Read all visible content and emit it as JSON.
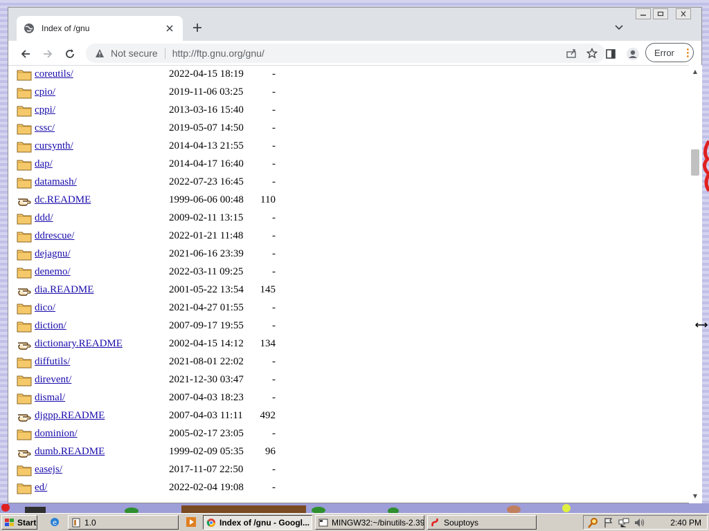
{
  "browser": {
    "tab_title": "Index of /gnu",
    "security_label": "Not secure",
    "url": "http://ftp.gnu.org/gnu/",
    "error_label": "Error"
  },
  "listing": [
    {
      "name": "coreutils/",
      "date": "2022-04-15 18:19",
      "size": "-",
      "type": "folder"
    },
    {
      "name": "cpio/",
      "date": "2019-11-06 03:25",
      "size": "-",
      "type": "folder"
    },
    {
      "name": "cppi/",
      "date": "2013-03-16 15:40",
      "size": "-",
      "type": "folder"
    },
    {
      "name": "cssc/",
      "date": "2019-05-07 14:50",
      "size": "-",
      "type": "folder"
    },
    {
      "name": "cursynth/",
      "date": "2014-04-13 21:55",
      "size": "-",
      "type": "folder"
    },
    {
      "name": "dap/",
      "date": "2014-04-17 16:40",
      "size": "-",
      "type": "folder"
    },
    {
      "name": "datamash/",
      "date": "2022-07-23 16:45",
      "size": "-",
      "type": "folder"
    },
    {
      "name": "dc.README",
      "date": "1999-06-06 00:48",
      "size": "110",
      "type": "readme"
    },
    {
      "name": "ddd/",
      "date": "2009-02-11 13:15",
      "size": "-",
      "type": "folder"
    },
    {
      "name": "ddrescue/",
      "date": "2022-01-21 11:48",
      "size": "-",
      "type": "folder"
    },
    {
      "name": "dejagnu/",
      "date": "2021-06-16 23:39",
      "size": "-",
      "type": "folder"
    },
    {
      "name": "denemo/",
      "date": "2022-03-11 09:25",
      "size": "-",
      "type": "folder"
    },
    {
      "name": "dia.README",
      "date": "2001-05-22 13:54",
      "size": "145",
      "type": "readme"
    },
    {
      "name": "dico/",
      "date": "2021-04-27 01:55",
      "size": "-",
      "type": "folder"
    },
    {
      "name": "diction/",
      "date": "2007-09-17 19:55",
      "size": "-",
      "type": "folder"
    },
    {
      "name": "dictionary.README",
      "date": "2002-04-15 14:12",
      "size": "134",
      "type": "readme"
    },
    {
      "name": "diffutils/",
      "date": "2021-08-01 22:02",
      "size": "-",
      "type": "folder"
    },
    {
      "name": "direvent/",
      "date": "2021-12-30 03:47",
      "size": "-",
      "type": "folder"
    },
    {
      "name": "dismal/",
      "date": "2007-04-03 18:23",
      "size": "-",
      "type": "folder"
    },
    {
      "name": "djgpp.README",
      "date": "2007-04-03 11:11",
      "size": "492",
      "type": "readme"
    },
    {
      "name": "dominion/",
      "date": "2005-02-17 23:05",
      "size": "-",
      "type": "folder"
    },
    {
      "name": "dumb.README",
      "date": "1999-02-09 05:35",
      "size": "96",
      "type": "readme"
    },
    {
      "name": "easejs/",
      "date": "2017-11-07 22:50",
      "size": "-",
      "type": "folder"
    },
    {
      "name": "ed/",
      "date": "2022-02-04 19:08",
      "size": "-",
      "type": "folder"
    }
  ],
  "taskbar": {
    "start_label": "Start",
    "tasks": [
      {
        "label": "1.0"
      },
      {
        "label": "Index of /gnu - Googl..."
      },
      {
        "label": "MINGW32:~/binutils-2.39"
      },
      {
        "label": "Souptoys"
      }
    ],
    "clock": "2:40 PM"
  }
}
